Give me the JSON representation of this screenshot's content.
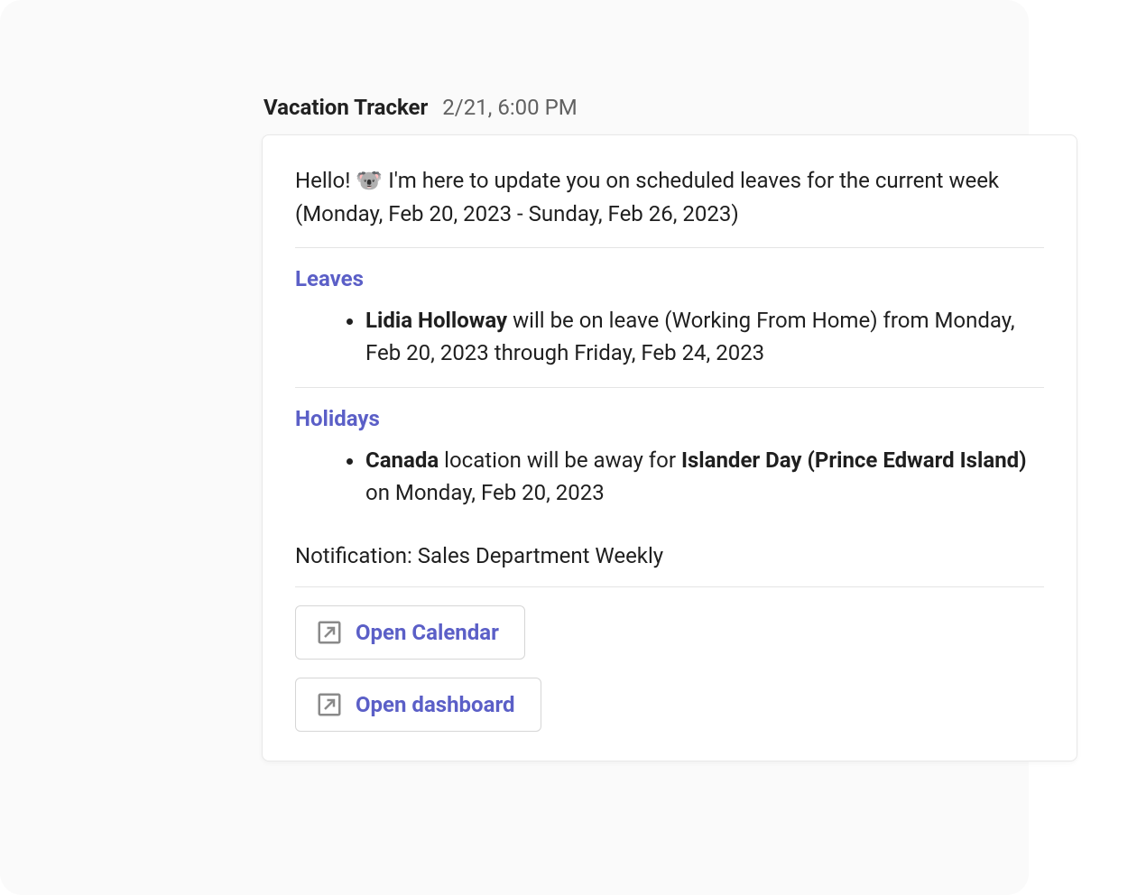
{
  "sender": "Vacation Tracker",
  "timestamp": "2/21, 6:00 PM",
  "intro_prefix": "Hello! ",
  "intro_emoji": "🐨",
  "intro_suffix": " I'm here to update you on scheduled leaves for the current week (Monday, Feb 20, 2023 - Sunday, Feb 26, 2023)",
  "leaves_heading": "Leaves",
  "leave_item_name": "Lidia Holloway",
  "leave_item_rest": " will be on leave (Working From Home) from Monday, Feb 20, 2023 through Friday, Feb 24, 2023",
  "holidays_heading": "Holidays",
  "holiday_location": "Canada",
  "holiday_mid": " location will be away for ",
  "holiday_name": "Islander Day (Prince Edward Island)",
  "holiday_rest": " on Monday, Feb 20, 2023",
  "notification_label": "Notification: Sales Department Weekly",
  "buttons": {
    "open_calendar": "Open Calendar",
    "open_dashboard": "Open dashboard"
  }
}
